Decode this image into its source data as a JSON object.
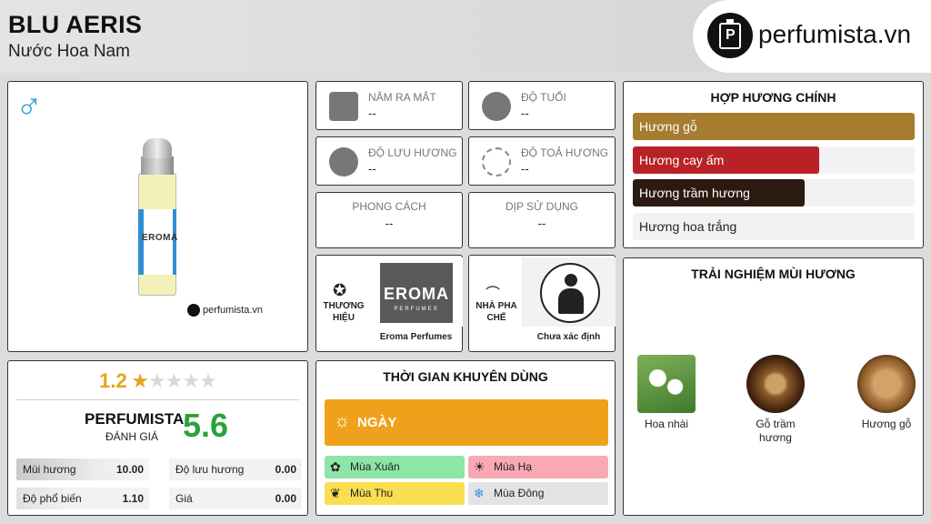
{
  "header": {
    "title": "BLU AERIS",
    "subtitle": "Nước Hoa Nam",
    "logo_text": "perfumista.vn"
  },
  "product": {
    "gender_icon": "male-symbol-icon",
    "bottle_label": "EROMA",
    "watermark": "perfumista.vn"
  },
  "info": {
    "release_year": {
      "label": "NĂM RA MẮT",
      "value": "--"
    },
    "age": {
      "label": "ĐỘ TUỔI",
      "value": "--"
    },
    "longevity": {
      "label": "ĐỘ LƯU HƯƠNG",
      "value": "--"
    },
    "sillage": {
      "label": "ĐỘ TOẢ HƯƠNG",
      "value": "--"
    },
    "style": {
      "label": "PHONG CÁCH",
      "value": "--"
    },
    "occasion": {
      "label": "DỊP SỬ DỤNG",
      "value": "--"
    }
  },
  "brand": {
    "label": "THƯƠNG HIỆU",
    "name": "Eroma Perfumes",
    "logo_big": "EROMA",
    "logo_small": "PERFUMES"
  },
  "perfumer": {
    "label": "NHÀ PHA CHẾ",
    "name": "Chưa xác định"
  },
  "accords": {
    "title": "HỢP HƯƠNG CHÍNH",
    "items": [
      {
        "name": "Hương gỗ",
        "percent": 100,
        "color": "#a67c2e",
        "text_color": "#ffffff"
      },
      {
        "name": "Hương cay ấm",
        "percent": 66,
        "color": "#b82226",
        "text_color": "#ffffff"
      },
      {
        "name": "Hương trầm hương",
        "percent": 61,
        "color": "#2a1a0f",
        "text_color": "#ffffff"
      },
      {
        "name": "Hương hoa trắng",
        "percent": 0,
        "color": "#ffffff",
        "text_color": "#222222"
      }
    ]
  },
  "experience": {
    "title": "TRẢI NGHIỆM MÙI HƯƠNG",
    "items": [
      {
        "name": "Hoa nhài"
      },
      {
        "name": "Gỗ trầm hương"
      },
      {
        "name": "Hương gỗ"
      }
    ]
  },
  "rating": {
    "score": "1.2",
    "stars_total": 5,
    "stars_filled": 1.2,
    "brand": "PERFUMISTA",
    "brand_sub": "ĐÁNH GIÁ",
    "brand_score": "5.6",
    "stats": [
      {
        "label": "Mùi hương",
        "value": "10.00"
      },
      {
        "label": "Độ lưu hương",
        "value": "0.00"
      },
      {
        "label": "Độ phổ biến",
        "value": "1.10"
      },
      {
        "label": "Giá",
        "value": "0.00"
      }
    ]
  },
  "time": {
    "title": "THỜI GIAN KHUYÊN DÙNG",
    "day_label": "NGÀY",
    "seasons": [
      {
        "label": "Mùa Xuân",
        "color": "#8de5a8"
      },
      {
        "label": "Mùa Hạ",
        "color": "#f8a9b3"
      },
      {
        "label": "Mùa Thu",
        "color": "#fade52"
      },
      {
        "label": "Mùa Đông",
        "color": "#e3e3e3"
      }
    ]
  },
  "colors": {
    "accent_orange": "#f0a11c",
    "score_green": "#26a33a",
    "star": "#e8a21c",
    "male_blue": "#3aa0dc"
  }
}
